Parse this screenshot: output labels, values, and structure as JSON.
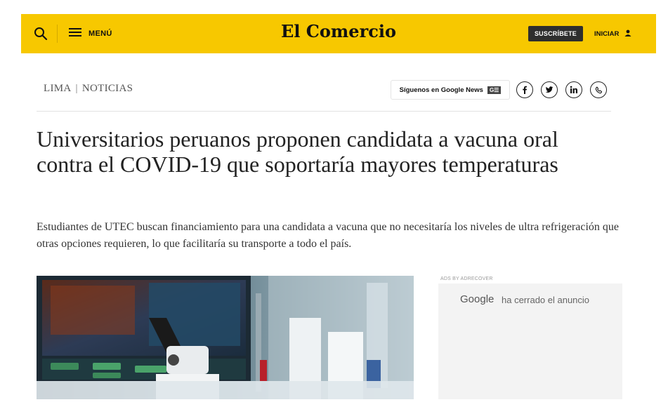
{
  "header": {
    "menu_label": "MENÚ",
    "logo_text": "El Comercio",
    "subscribe_label": "SUSCRÍBETE",
    "login_label": "INICIAR",
    "bg_color": "#f7c800"
  },
  "breadcrumb": {
    "section": "LIMA",
    "separator": "|",
    "category": "NOTICIAS"
  },
  "follow": {
    "google_news_label": "Síguenos en Google News",
    "google_news_badge": "G☰",
    "icons": [
      "facebook-icon",
      "twitter-icon",
      "linkedin-icon",
      "whatsapp-icon"
    ]
  },
  "article": {
    "headline": "Universitarios peruanos proponen candidata a vacuna oral contra el COVID-19 que soportaría mayores temperaturas",
    "summary": "Estudiantes de UTEC buscan financiamiento para una candidata a vacuna que no necesitaría los niveles de ultra refrigeración que otras opciones requieren, lo que facilitaría su transporte a todo el país."
  },
  "ad": {
    "label": "ADS BY ADRECOVER",
    "google_text": "Google",
    "closed_text": "ha cerrado el anuncio"
  }
}
